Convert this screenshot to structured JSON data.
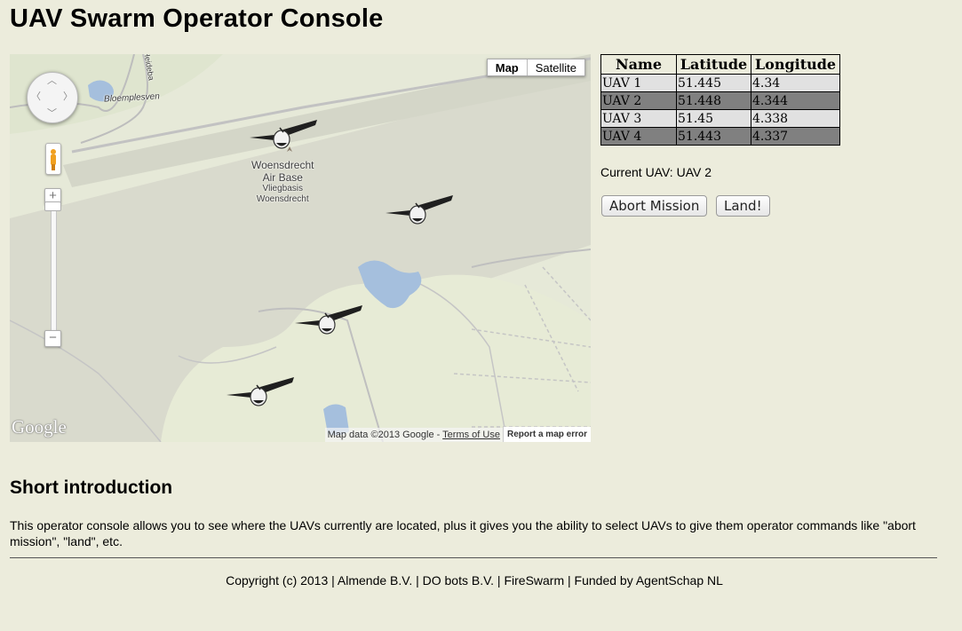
{
  "page": {
    "title": "UAV Swarm Operator Console"
  },
  "map": {
    "type_controls": [
      "Map",
      "Satellite"
    ],
    "active_type": "Map",
    "labels": {
      "lake": "Bloemplesven",
      "road": "Heideba",
      "airbase_line1": "Woensdrecht",
      "airbase_line2": "Air Base",
      "airbase_line3": "Vliegbasis",
      "airbase_line4": "Woensdrecht"
    },
    "logo": "Google",
    "attribution": "Map data ©2013 Google - ",
    "terms_link": "Terms of Use",
    "report_error": "Report a map error",
    "zoom_in": "+",
    "zoom_out": "−",
    "markers": [
      {
        "name": "UAV 1",
        "icon": "aircraft-icon"
      },
      {
        "name": "UAV 2",
        "icon": "aircraft-icon"
      },
      {
        "name": "UAV 3",
        "icon": "aircraft-icon"
      },
      {
        "name": "UAV 4",
        "icon": "aircraft-icon"
      }
    ]
  },
  "uav_table": {
    "headers": [
      "Name",
      "Latitude",
      "Longitude"
    ],
    "rows": [
      {
        "name": "UAV 1",
        "lat": "51.445",
        "lon": "4.34"
      },
      {
        "name": "UAV 2",
        "lat": "51.448",
        "lon": "4.344"
      },
      {
        "name": "UAV 3",
        "lat": "51.45",
        "lon": "4.338"
      },
      {
        "name": "UAV 4",
        "lat": "51.443",
        "lon": "4.337"
      }
    ]
  },
  "status": {
    "current_uav": "Current UAV: UAV 2"
  },
  "actions": {
    "abort": "Abort Mission",
    "land": "Land!"
  },
  "intro": {
    "heading": "Short introduction",
    "text": "This operator console allows you to see where the UAVs currently are located, plus it gives you the ability to select UAVs to give them operator commands like \"abort mission\", \"land\", etc."
  },
  "footer": {
    "text": "Copyright (c) 2013 | Almende B.V. | DO bots B.V. | FireSwarm | Funded by AgentSchap NL"
  },
  "colors": {
    "background": "#ececdc",
    "row_light": "#e1e1e1",
    "row_dark": "#808080",
    "water": "#a5bfdd",
    "map_land": "#e3e7d6",
    "map_grey": "#d6d7cc"
  }
}
